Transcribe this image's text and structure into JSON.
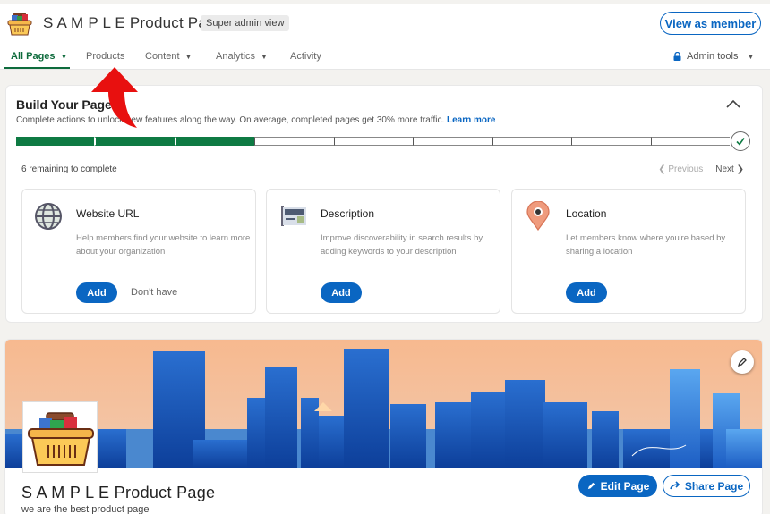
{
  "header": {
    "page_title": "S A M P L E Product Page",
    "admin_badge": "Super admin view",
    "view_as_member": "View as member"
  },
  "nav": {
    "items": [
      {
        "label": "All Pages",
        "has_dropdown": true,
        "active": true
      },
      {
        "label": "Products",
        "has_dropdown": false,
        "active": false
      },
      {
        "label": "Content",
        "has_dropdown": true,
        "active": false
      },
      {
        "label": "Analytics",
        "has_dropdown": true,
        "active": false
      },
      {
        "label": "Activity",
        "has_dropdown": false,
        "active": false
      }
    ],
    "admin_tools": "Admin tools"
  },
  "build": {
    "title": "Build Your Page",
    "subtitle": "Complete actions to unlock new features along the way. On average, completed pages get 30% more traffic.",
    "learn_more": "Learn more",
    "progress": {
      "completed_steps": 3,
      "total_steps": 9
    },
    "remaining": "6 remaining to complete",
    "previous": "Previous",
    "next": "Next",
    "tasks": [
      {
        "title": "Website URL",
        "description": "Help members find your website to learn more about your organization",
        "add": "Add",
        "secondary": "Don't have",
        "icon": "globe-icon"
      },
      {
        "title": "Description",
        "description": "Improve discoverability in search results by adding keywords to your description",
        "add": "Add",
        "icon": "description-icon"
      },
      {
        "title": "Location",
        "description": "Let members know where you're based by sharing a location",
        "add": "Add",
        "icon": "location-pin-icon"
      }
    ]
  },
  "profile": {
    "name": "S A M P L E Product Page",
    "tagline": "we are the best product page",
    "edit_page": "Edit Page",
    "share_page": "Share Page"
  },
  "colors": {
    "brand_blue": "#0a66c2",
    "progress_green": "#0e7a43",
    "annotation_red": "#e8100f"
  }
}
